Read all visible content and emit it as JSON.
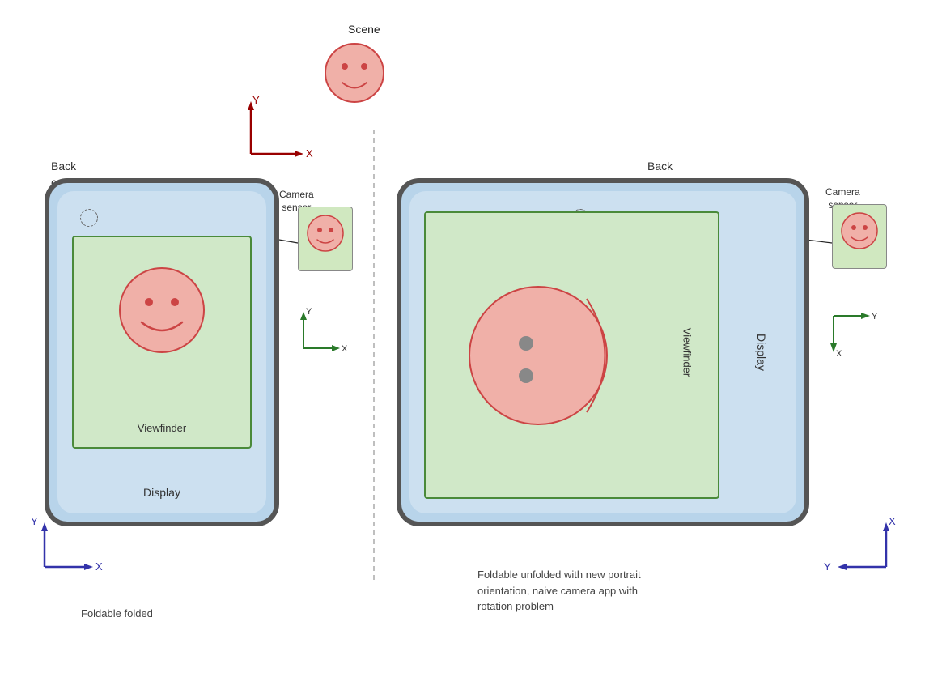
{
  "scene": {
    "label": "Scene"
  },
  "axes_top": {
    "y_label": "Y",
    "x_label": "X",
    "color": "#990000"
  },
  "left_phone": {
    "back_camera_label": "Back\ncamera",
    "camera_sensor_label": "Camera\nsensor",
    "viewfinder_label": "Viewfinder",
    "display_label": "Display",
    "caption": "Foldable folded",
    "axes_y": "Y",
    "axes_x": "X",
    "sensor_axes_y": "Y",
    "sensor_axes_x": "X"
  },
  "right_phone": {
    "back_camera_label": "Back\ncamera",
    "camera_sensor_label": "Camera\nsensor",
    "viewfinder_label": "Viewfinder",
    "display_label": "Display",
    "caption": "Foldable unfolded with new portrait\norientation, naive camera app with\nrotation problem",
    "axes_y": "Y",
    "axes_x": "X",
    "sensor_axes_y": "Y",
    "sensor_axes_x": "X"
  }
}
